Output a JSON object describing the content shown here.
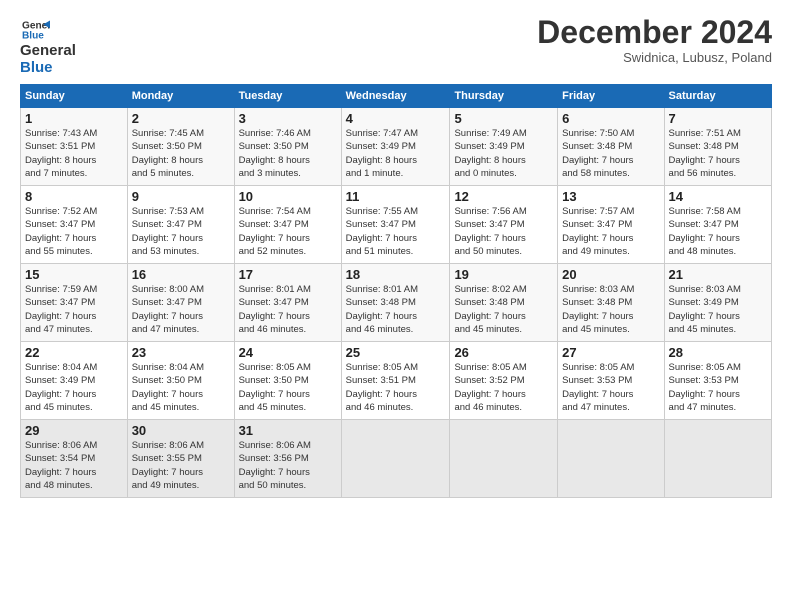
{
  "logo": {
    "line1": "General",
    "line2": "Blue"
  },
  "title": "December 2024",
  "subtitle": "Swidnica, Lubusz, Poland",
  "days_header": [
    "Sunday",
    "Monday",
    "Tuesday",
    "Wednesday",
    "Thursday",
    "Friday",
    "Saturday"
  ],
  "weeks": [
    [
      {
        "num": "1",
        "info": "Sunrise: 7:43 AM\nSunset: 3:51 PM\nDaylight: 8 hours\nand 7 minutes."
      },
      {
        "num": "2",
        "info": "Sunrise: 7:45 AM\nSunset: 3:50 PM\nDaylight: 8 hours\nand 5 minutes."
      },
      {
        "num": "3",
        "info": "Sunrise: 7:46 AM\nSunset: 3:50 PM\nDaylight: 8 hours\nand 3 minutes."
      },
      {
        "num": "4",
        "info": "Sunrise: 7:47 AM\nSunset: 3:49 PM\nDaylight: 8 hours\nand 1 minute."
      },
      {
        "num": "5",
        "info": "Sunrise: 7:49 AM\nSunset: 3:49 PM\nDaylight: 8 hours\nand 0 minutes."
      },
      {
        "num": "6",
        "info": "Sunrise: 7:50 AM\nSunset: 3:48 PM\nDaylight: 7 hours\nand 58 minutes."
      },
      {
        "num": "7",
        "info": "Sunrise: 7:51 AM\nSunset: 3:48 PM\nDaylight: 7 hours\nand 56 minutes."
      }
    ],
    [
      {
        "num": "8",
        "info": "Sunrise: 7:52 AM\nSunset: 3:47 PM\nDaylight: 7 hours\nand 55 minutes."
      },
      {
        "num": "9",
        "info": "Sunrise: 7:53 AM\nSunset: 3:47 PM\nDaylight: 7 hours\nand 53 minutes."
      },
      {
        "num": "10",
        "info": "Sunrise: 7:54 AM\nSunset: 3:47 PM\nDaylight: 7 hours\nand 52 minutes."
      },
      {
        "num": "11",
        "info": "Sunrise: 7:55 AM\nSunset: 3:47 PM\nDaylight: 7 hours\nand 51 minutes."
      },
      {
        "num": "12",
        "info": "Sunrise: 7:56 AM\nSunset: 3:47 PM\nDaylight: 7 hours\nand 50 minutes."
      },
      {
        "num": "13",
        "info": "Sunrise: 7:57 AM\nSunset: 3:47 PM\nDaylight: 7 hours\nand 49 minutes."
      },
      {
        "num": "14",
        "info": "Sunrise: 7:58 AM\nSunset: 3:47 PM\nDaylight: 7 hours\nand 48 minutes."
      }
    ],
    [
      {
        "num": "15",
        "info": "Sunrise: 7:59 AM\nSunset: 3:47 PM\nDaylight: 7 hours\nand 47 minutes."
      },
      {
        "num": "16",
        "info": "Sunrise: 8:00 AM\nSunset: 3:47 PM\nDaylight: 7 hours\nand 47 minutes."
      },
      {
        "num": "17",
        "info": "Sunrise: 8:01 AM\nSunset: 3:47 PM\nDaylight: 7 hours\nand 46 minutes."
      },
      {
        "num": "18",
        "info": "Sunrise: 8:01 AM\nSunset: 3:48 PM\nDaylight: 7 hours\nand 46 minutes."
      },
      {
        "num": "19",
        "info": "Sunrise: 8:02 AM\nSunset: 3:48 PM\nDaylight: 7 hours\nand 45 minutes."
      },
      {
        "num": "20",
        "info": "Sunrise: 8:03 AM\nSunset: 3:48 PM\nDaylight: 7 hours\nand 45 minutes."
      },
      {
        "num": "21",
        "info": "Sunrise: 8:03 AM\nSunset: 3:49 PM\nDaylight: 7 hours\nand 45 minutes."
      }
    ],
    [
      {
        "num": "22",
        "info": "Sunrise: 8:04 AM\nSunset: 3:49 PM\nDaylight: 7 hours\nand 45 minutes."
      },
      {
        "num": "23",
        "info": "Sunrise: 8:04 AM\nSunset: 3:50 PM\nDaylight: 7 hours\nand 45 minutes."
      },
      {
        "num": "24",
        "info": "Sunrise: 8:05 AM\nSunset: 3:50 PM\nDaylight: 7 hours\nand 45 minutes."
      },
      {
        "num": "25",
        "info": "Sunrise: 8:05 AM\nSunset: 3:51 PM\nDaylight: 7 hours\nand 46 minutes."
      },
      {
        "num": "26",
        "info": "Sunrise: 8:05 AM\nSunset: 3:52 PM\nDaylight: 7 hours\nand 46 minutes."
      },
      {
        "num": "27",
        "info": "Sunrise: 8:05 AM\nSunset: 3:53 PM\nDaylight: 7 hours\nand 47 minutes."
      },
      {
        "num": "28",
        "info": "Sunrise: 8:05 AM\nSunset: 3:53 PM\nDaylight: 7 hours\nand 47 minutes."
      }
    ],
    [
      {
        "num": "29",
        "info": "Sunrise: 8:06 AM\nSunset: 3:54 PM\nDaylight: 7 hours\nand 48 minutes."
      },
      {
        "num": "30",
        "info": "Sunrise: 8:06 AM\nSunset: 3:55 PM\nDaylight: 7 hours\nand 49 minutes."
      },
      {
        "num": "31",
        "info": "Sunrise: 8:06 AM\nSunset: 3:56 PM\nDaylight: 7 hours\nand 50 minutes."
      },
      {
        "num": "",
        "info": ""
      },
      {
        "num": "",
        "info": ""
      },
      {
        "num": "",
        "info": ""
      },
      {
        "num": "",
        "info": ""
      }
    ]
  ]
}
